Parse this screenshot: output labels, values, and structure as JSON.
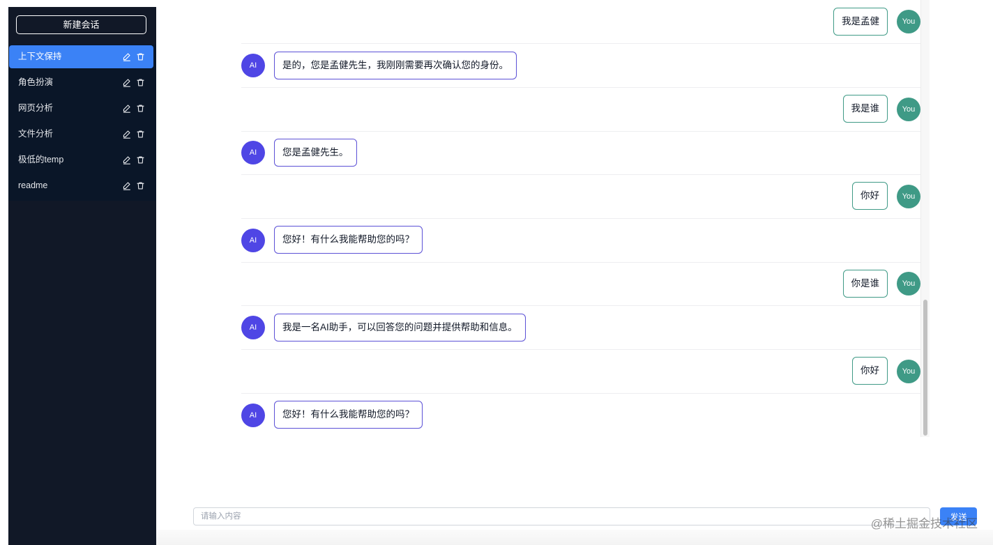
{
  "sidebar": {
    "new_chat_label": "新建会话",
    "conversations": [
      {
        "label": "上下文保持",
        "active": true
      },
      {
        "label": "角色扮演",
        "active": false
      },
      {
        "label": "网页分析",
        "active": false
      },
      {
        "label": "文件分析",
        "active": false
      },
      {
        "label": "极低的temp",
        "active": false
      },
      {
        "label": "readme",
        "active": false
      }
    ]
  },
  "chat": {
    "ai_avatar_label": "AI",
    "user_avatar_label": "You",
    "messages": [
      {
        "role": "user",
        "text": "我是孟健"
      },
      {
        "role": "ai",
        "text": "是的，您是孟健先生，我刚刚需要再次确认您的身份。"
      },
      {
        "role": "user",
        "text": "我是谁"
      },
      {
        "role": "ai",
        "text": "您是孟健先生。"
      },
      {
        "role": "user",
        "text": "你好"
      },
      {
        "role": "ai",
        "text": "您好！有什么我能帮助您的吗？"
      },
      {
        "role": "user",
        "text": "你是谁"
      },
      {
        "role": "ai",
        "text": "我是一名AI助手，可以回答您的问题并提供帮助和信息。"
      },
      {
        "role": "user",
        "text": "你好"
      },
      {
        "role": "ai",
        "text": "您好！有什么我能帮助您的吗？"
      }
    ]
  },
  "input": {
    "placeholder": "请输入内容",
    "value": "",
    "send_label": "发送"
  },
  "watermark": "@稀土掘金技术社区",
  "colors": {
    "sidebar_bg": "#111827",
    "active_item": "#3b82f6",
    "ai_avatar": "#4f46e5",
    "user_avatar": "#3f9a86",
    "send_button": "#3b82f6"
  }
}
